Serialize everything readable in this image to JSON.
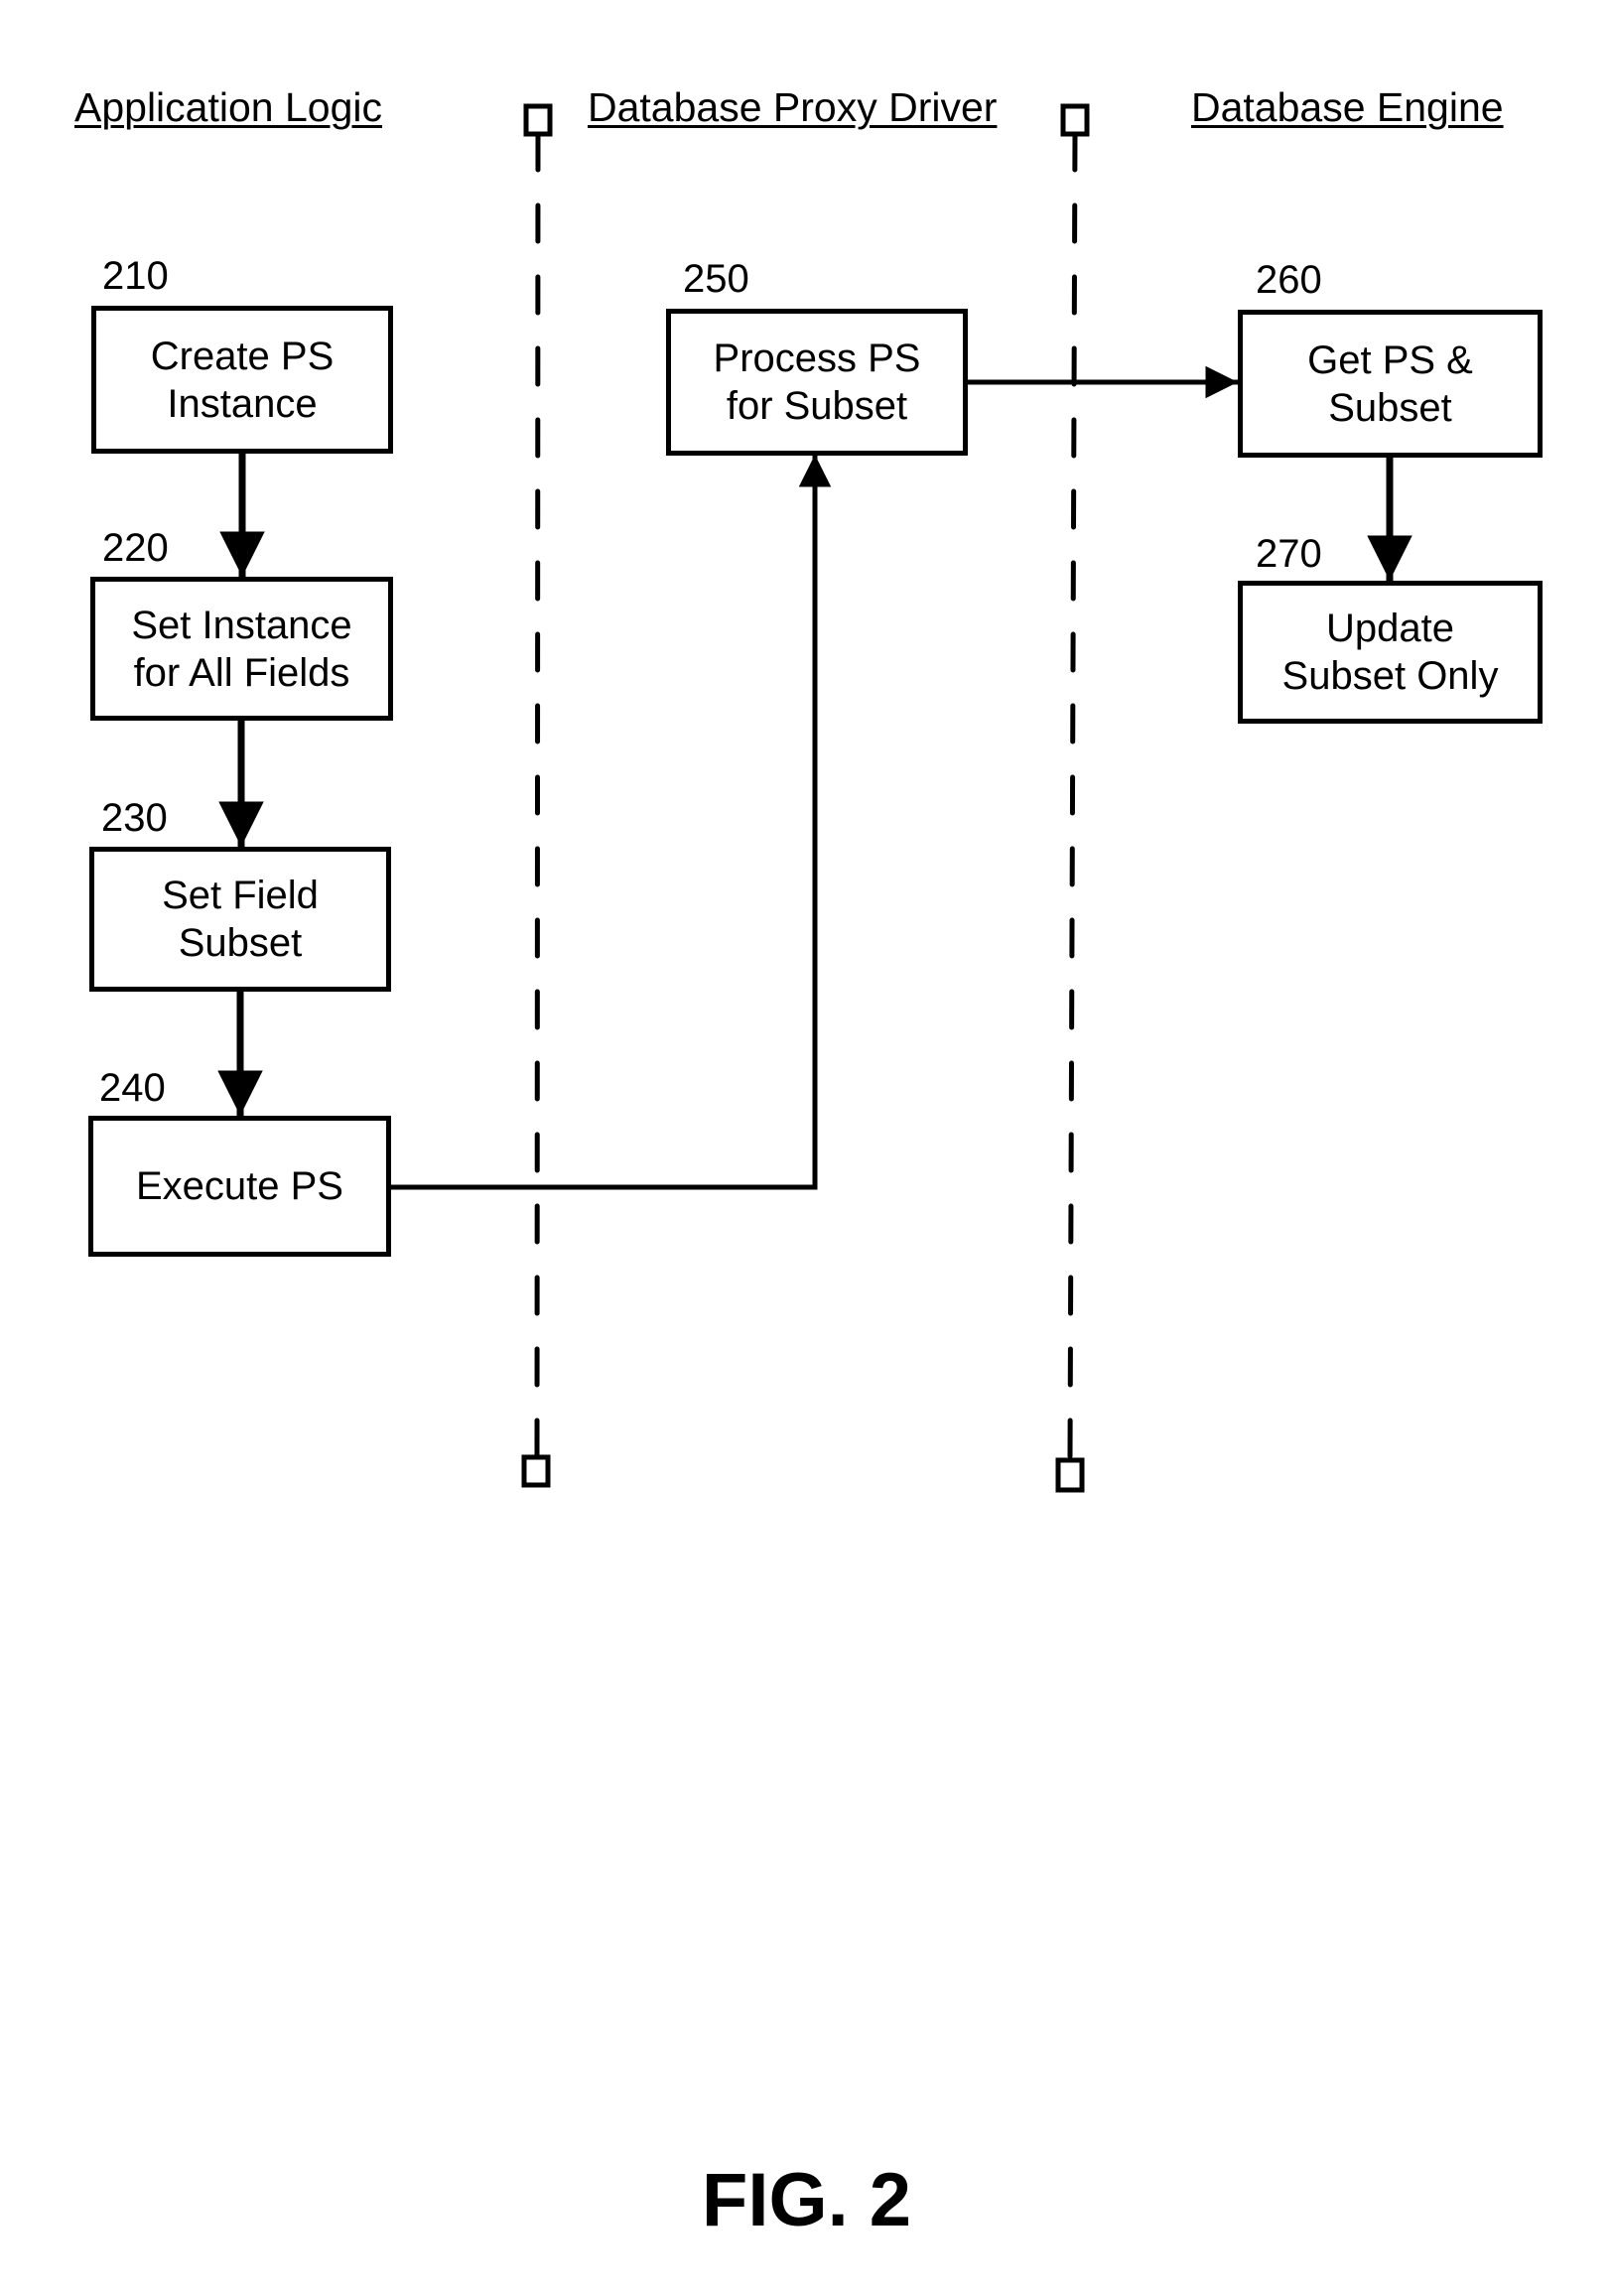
{
  "figure": {
    "title": "FIG. 2",
    "lanes": [
      {
        "id": "app",
        "header": "Application Logic"
      },
      {
        "id": "proxy",
        "header": "Database Proxy Driver"
      },
      {
        "id": "engine",
        "header": "Database Engine"
      }
    ],
    "steps": [
      {
        "ref": "210",
        "lane": "app",
        "label": "Create PS\nInstance"
      },
      {
        "ref": "220",
        "lane": "app",
        "label": "Set Instance\nfor All Fields"
      },
      {
        "ref": "230",
        "lane": "app",
        "label": "Set Field\nSubset"
      },
      {
        "ref": "240",
        "lane": "app",
        "label": "Execute PS"
      },
      {
        "ref": "250",
        "lane": "proxy",
        "label": "Process PS\nfor Subset"
      },
      {
        "ref": "260",
        "lane": "engine",
        "label": "Get PS &\nSubset"
      },
      {
        "ref": "270",
        "lane": "engine",
        "label": "Update\nSubset Only"
      }
    ],
    "flows": [
      {
        "from": "210",
        "to": "220"
      },
      {
        "from": "220",
        "to": "230"
      },
      {
        "from": "230",
        "to": "240"
      },
      {
        "from": "240",
        "to": "250"
      },
      {
        "from": "250",
        "to": "260"
      },
      {
        "from": "260",
        "to": "270"
      }
    ]
  }
}
